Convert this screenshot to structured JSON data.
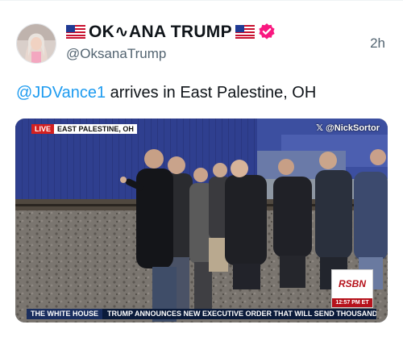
{
  "post": {
    "display_name": "OK∿ANA TRUMP",
    "handle": "@OksanaTrump",
    "timestamp": "2h",
    "text_mention": "@JDVance1",
    "text_rest": " arrives in East Palestine, OH"
  },
  "video": {
    "live_label": "LIVE",
    "location_label": "EAST PALESTINE, OH",
    "credit": "@NickSortor",
    "network_logo": "RSBN",
    "network_time": "12:57 PM ET",
    "ticker_source": "THE WHITE HOUSE",
    "ticker_headline": "TRUMP ANNOUNCES NEW EXECUTIVE ORDER THAT WILL SEND THOUSANDS"
  },
  "icons": {
    "flag": "us-flag-icon",
    "verified": "verified-badge-icon",
    "x_logo": "x-logo-icon"
  },
  "colors": {
    "link": "#1d9bf0",
    "verified": "#f91880",
    "live": "#d32020",
    "text": "#0f1419",
    "secondary": "#536471"
  }
}
